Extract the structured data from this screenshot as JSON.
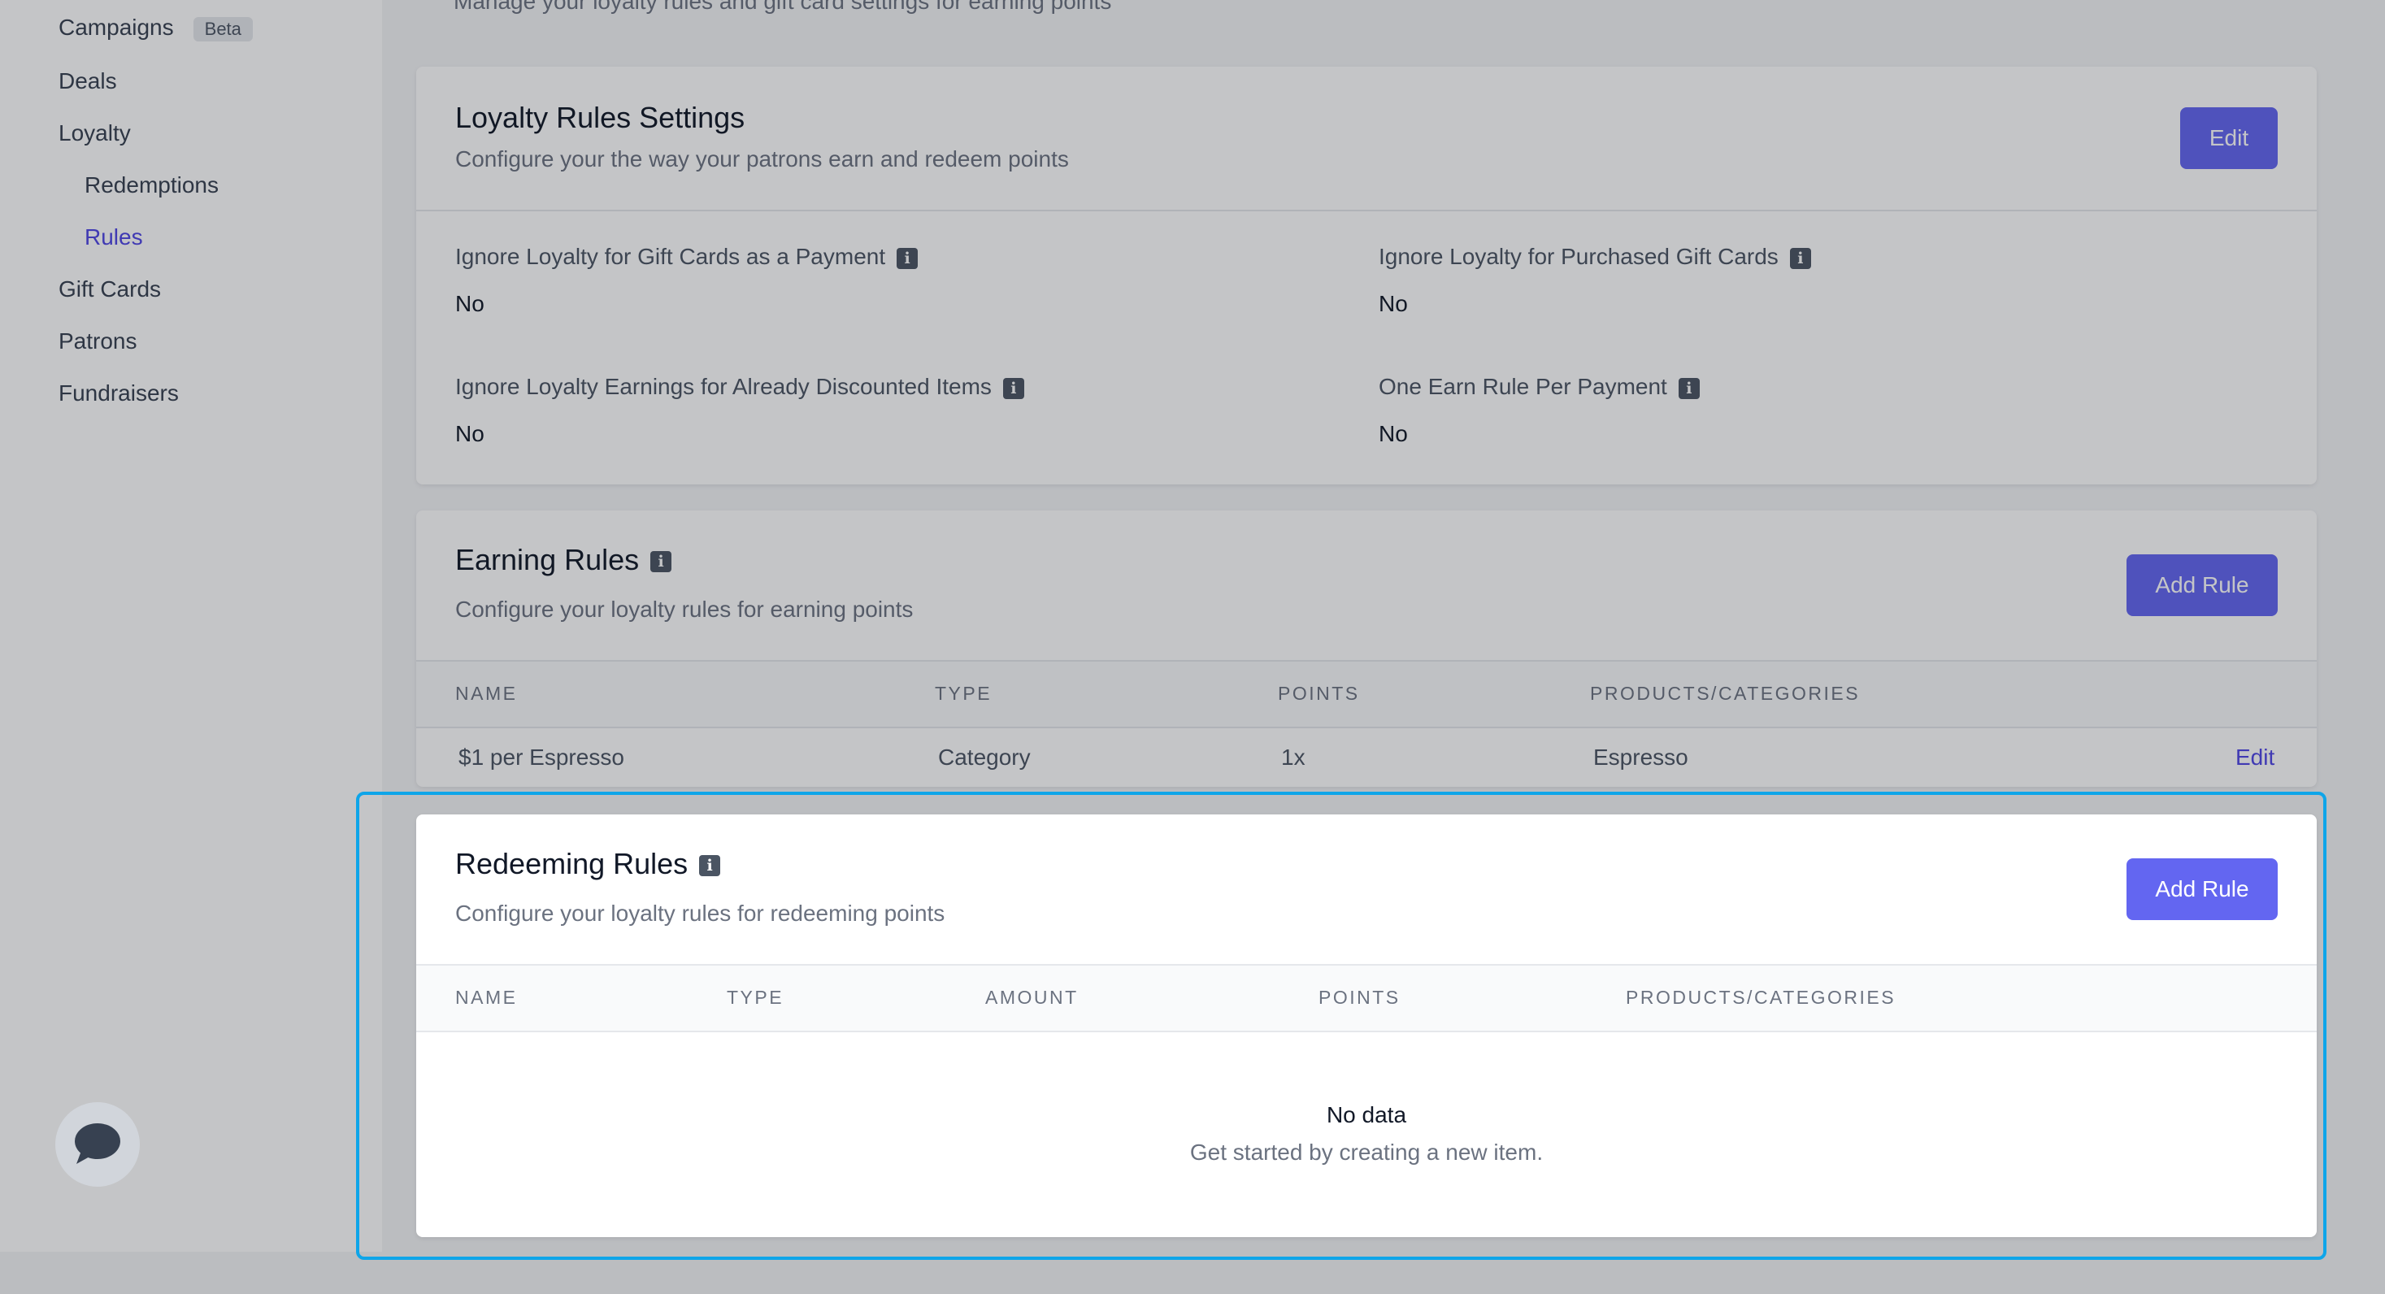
{
  "sidebar": {
    "items": [
      {
        "label": "Campaigns",
        "badge": "Beta"
      },
      {
        "label": "Deals"
      },
      {
        "label": "Loyalty"
      },
      {
        "label": "Redemptions"
      },
      {
        "label": "Rules"
      },
      {
        "label": "Gift Cards"
      },
      {
        "label": "Patrons"
      },
      {
        "label": "Fundraisers"
      }
    ]
  },
  "top_text": "Manage your loyalty rules and gift card settings for earning points",
  "settings": {
    "title": "Loyalty Rules Settings",
    "subtitle": "Configure your the way your patrons earn and redeem points",
    "edit_label": "Edit",
    "fields": [
      {
        "label": "Ignore Loyalty for Gift Cards as a Payment",
        "value": "No"
      },
      {
        "label": "Ignore Loyalty for Purchased Gift Cards",
        "value": "No"
      },
      {
        "label": "Ignore Loyalty Earnings for Already Discounted Items",
        "value": "No"
      },
      {
        "label": "One Earn Rule Per Payment",
        "value": "No"
      }
    ]
  },
  "earning": {
    "title": "Earning Rules",
    "subtitle": "Configure your loyalty rules for earning points",
    "add_label": "Add Rule",
    "columns": [
      "NAME",
      "TYPE",
      "POINTS",
      "PRODUCTS/CATEGORIES"
    ],
    "rows": [
      {
        "name": "$1 per Espresso",
        "type": "Category",
        "points": "1x",
        "products": "Espresso",
        "action": "Edit"
      }
    ]
  },
  "redeeming": {
    "title": "Redeeming Rules",
    "subtitle": "Configure your loyalty rules for redeeming points",
    "add_label": "Add Rule",
    "columns": [
      "NAME",
      "TYPE",
      "AMOUNT",
      "POINTS",
      "PRODUCTS/CATEGORIES"
    ],
    "empty_title": "No data",
    "empty_subtitle": "Get started by creating a new item."
  },
  "icons": {
    "info": "info-icon",
    "chat": "chat-bubble-icon"
  },
  "colors": {
    "accent": "#6366f1",
    "link": "#4f46e5",
    "highlight": "#0ea5e9"
  }
}
